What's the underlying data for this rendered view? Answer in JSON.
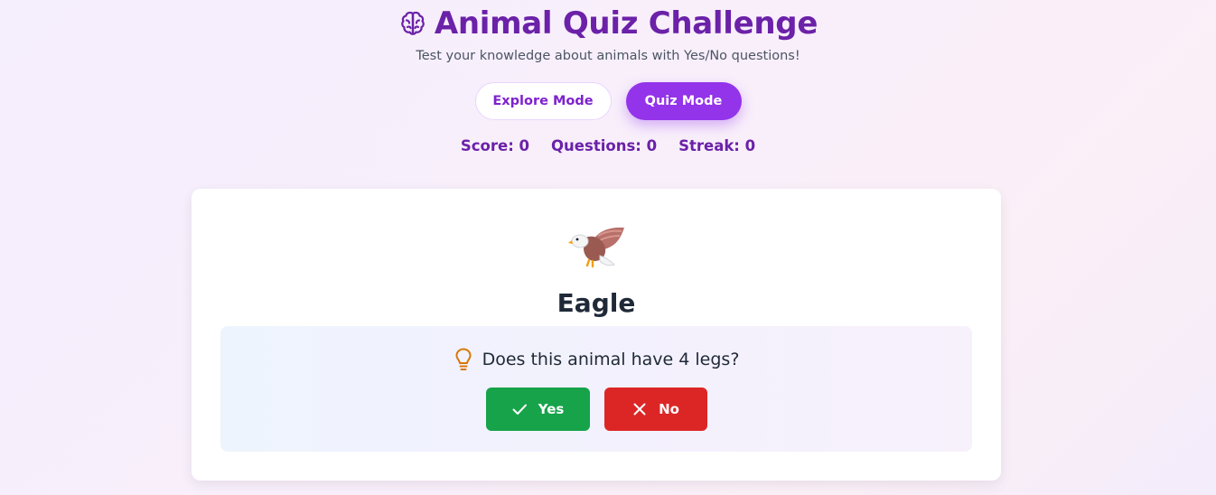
{
  "header": {
    "title": "Animal Quiz Challenge",
    "title_icon": "brain-icon",
    "subtitle": "Test your knowledge about animals with Yes/No questions!"
  },
  "modes": {
    "explore_label": "Explore Mode",
    "quiz_label": "Quiz Mode",
    "active": "Quiz Mode"
  },
  "stats": {
    "score": "Score: 0",
    "questions": "Questions: 0",
    "streak": "Streak: 0"
  },
  "card": {
    "animal_icon": "eagle-icon",
    "animal_name": "Eagle",
    "question_icon": "lightbulb-icon",
    "question": "Does this animal have 4 legs?",
    "yes_label": "Yes",
    "yes_icon": "check-icon",
    "no_label": "No",
    "no_icon": "x-icon"
  },
  "colors": {
    "brand": "#6b21a8",
    "accent": "#9333ea",
    "yes": "#16a34a",
    "no": "#dc2626",
    "bulb": "#d97706"
  }
}
